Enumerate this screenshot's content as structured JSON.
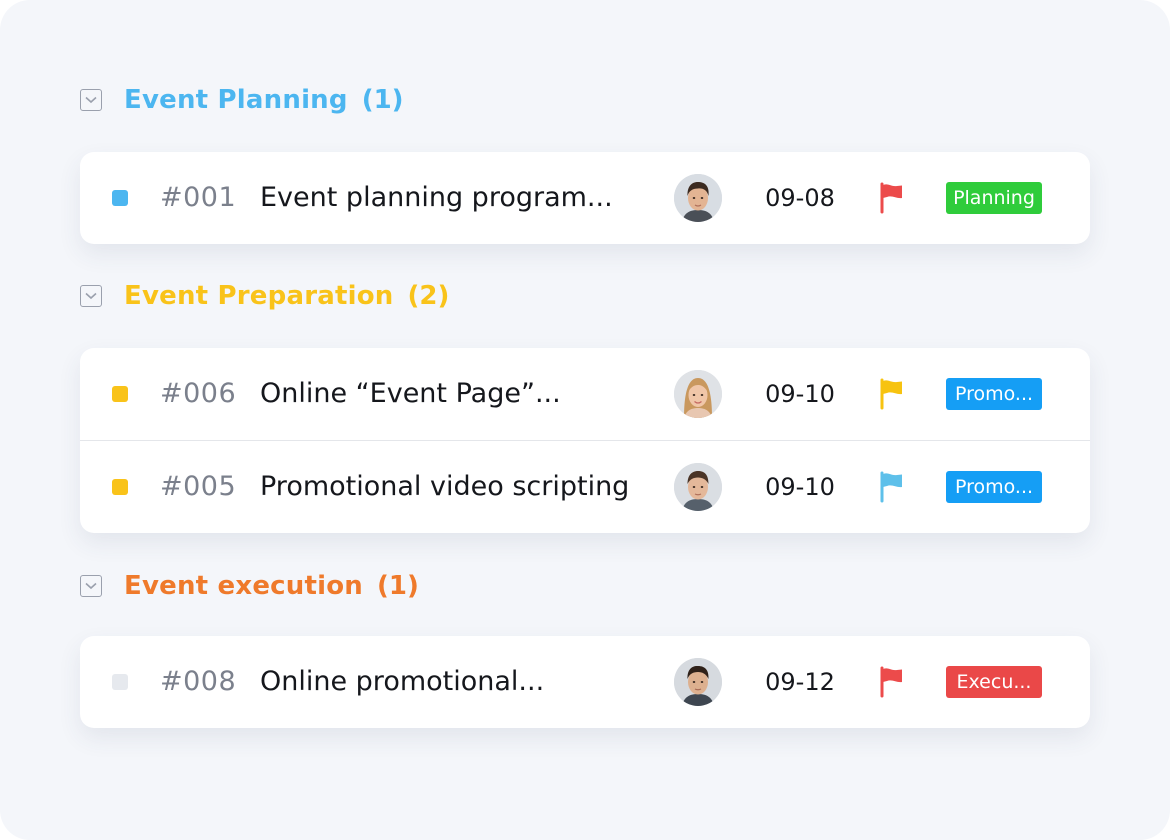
{
  "groups": [
    {
      "title": "Event Planning",
      "count": "(1)",
      "color": "#4cb6f0",
      "tasks": [
        {
          "id": "#001",
          "name": "Event planning program...",
          "date": "09-08",
          "status_color": "#4cb6f0",
          "flag_color": "#ec4b4b",
          "tag": "Planning",
          "tag_color": "#2fcc3b",
          "avatar": "male-avatar"
        }
      ]
    },
    {
      "title": "Event Preparation",
      "count": "(2)",
      "color": "#f9c31a",
      "tasks": [
        {
          "id": "#006",
          "name": "Online “Event Page”...",
          "date": "09-10",
          "status_color": "#f9c31a",
          "flag_color": "#f7c310",
          "tag": "Promo...",
          "tag_color": "#159ef5",
          "avatar": "female-avatar"
        },
        {
          "id": "#005",
          "name": "Promotional video scripting",
          "date": "09-10",
          "status_color": "#f9c31a",
          "flag_color": "#5ec0ea",
          "tag": "Promo...",
          "tag_color": "#159ef5",
          "avatar": "male-avatar"
        }
      ]
    },
    {
      "title": "Event execution",
      "count": "(1)",
      "color": "#ef7a2b",
      "tasks": [
        {
          "id": "#008",
          "name": "Online promotional...",
          "date": "09-12",
          "status_color": "#e6e9ee",
          "flag_color": "#ec4b4b",
          "tag": "Execu...",
          "tag_color": "#ea4848",
          "avatar": "male-avatar"
        }
      ]
    }
  ]
}
